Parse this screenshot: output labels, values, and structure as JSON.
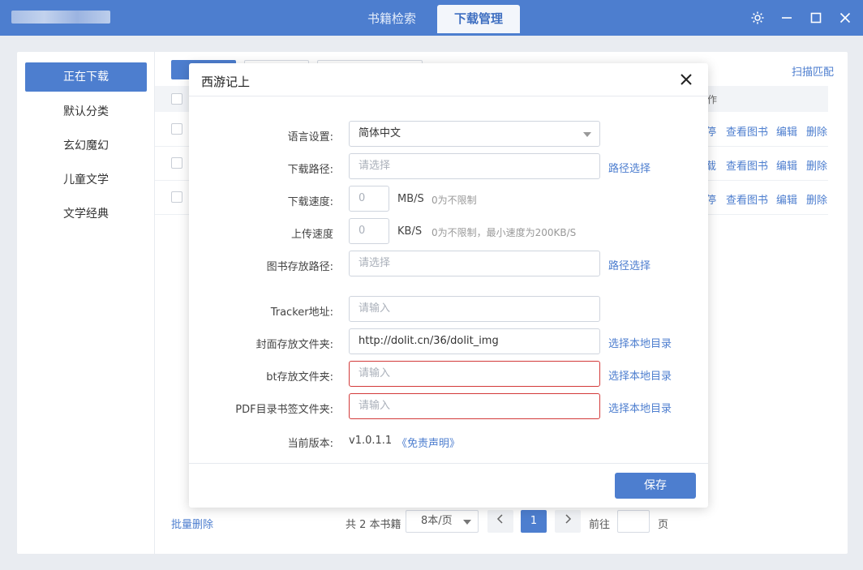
{
  "window": {
    "tabs": {
      "search": "书籍检索",
      "download": "下载管理"
    },
    "icons": [
      "gear-icon",
      "minimize-icon",
      "maximize-icon",
      "close-icon"
    ]
  },
  "sidebar": {
    "items": [
      {
        "label": "正在下载",
        "active": true
      },
      {
        "label": "默认分类"
      },
      {
        "label": "玄幻魔幻"
      },
      {
        "label": "儿童文学"
      },
      {
        "label": "文学经典"
      }
    ]
  },
  "toolbar": {
    "scan_label": "扫描匹配",
    "op_header_fragment": "作"
  },
  "rows": [
    {
      "first_action": "停",
      "actions": [
        "查看图书",
        "编辑",
        "删除"
      ]
    },
    {
      "first_action": "载",
      "actions": [
        "查看图书",
        "编辑",
        "删除"
      ]
    },
    {
      "first_action": "停",
      "actions": [
        "查看图书",
        "编辑",
        "删除"
      ]
    }
  ],
  "footer": {
    "bulk_delete": "批量删除",
    "total": "共 2 本书籍",
    "page_size": "8本/页",
    "current_page": "1",
    "goto_label": "前往",
    "page_suffix": "页"
  },
  "dialog": {
    "title": "西游记上",
    "language": {
      "label": "语言设置:",
      "value": "简体中文"
    },
    "download_path": {
      "label": "下载路径:",
      "placeholder": "请选择",
      "link": "路径选择"
    },
    "download_speed": {
      "label": "下载速度:",
      "value": "0",
      "unit": "MB/S",
      "hint": "0为不限制"
    },
    "upload_speed": {
      "label": "上传速度",
      "value": "0",
      "unit": "KB/S",
      "hint": "0为不限制，最小速度为200KB/S"
    },
    "book_path": {
      "label": "图书存放路径:",
      "placeholder": "请选择",
      "link": "路径选择"
    },
    "tracker": {
      "label": "Tracker地址:",
      "placeholder": "请输入"
    },
    "cover_folder": {
      "label": "封面存放文件夹:",
      "value": "http://dolit.cn/36/dolit_img",
      "link": "选择本地目录"
    },
    "bt_folder": {
      "label": "bt存放文件夹:",
      "placeholder": "请输入",
      "link": "选择本地目录"
    },
    "pdf_folder": {
      "label": "PDF目录书签文件夹:",
      "placeholder": "请输入",
      "link": "选择本地目录"
    },
    "version": {
      "label": "当前版本:",
      "value": "v1.0.1.1",
      "disclaimer": "《免责声明》"
    },
    "save_label": "保存"
  },
  "colors": {
    "accent": "#4d7ecf",
    "error": "#d33a3a"
  }
}
